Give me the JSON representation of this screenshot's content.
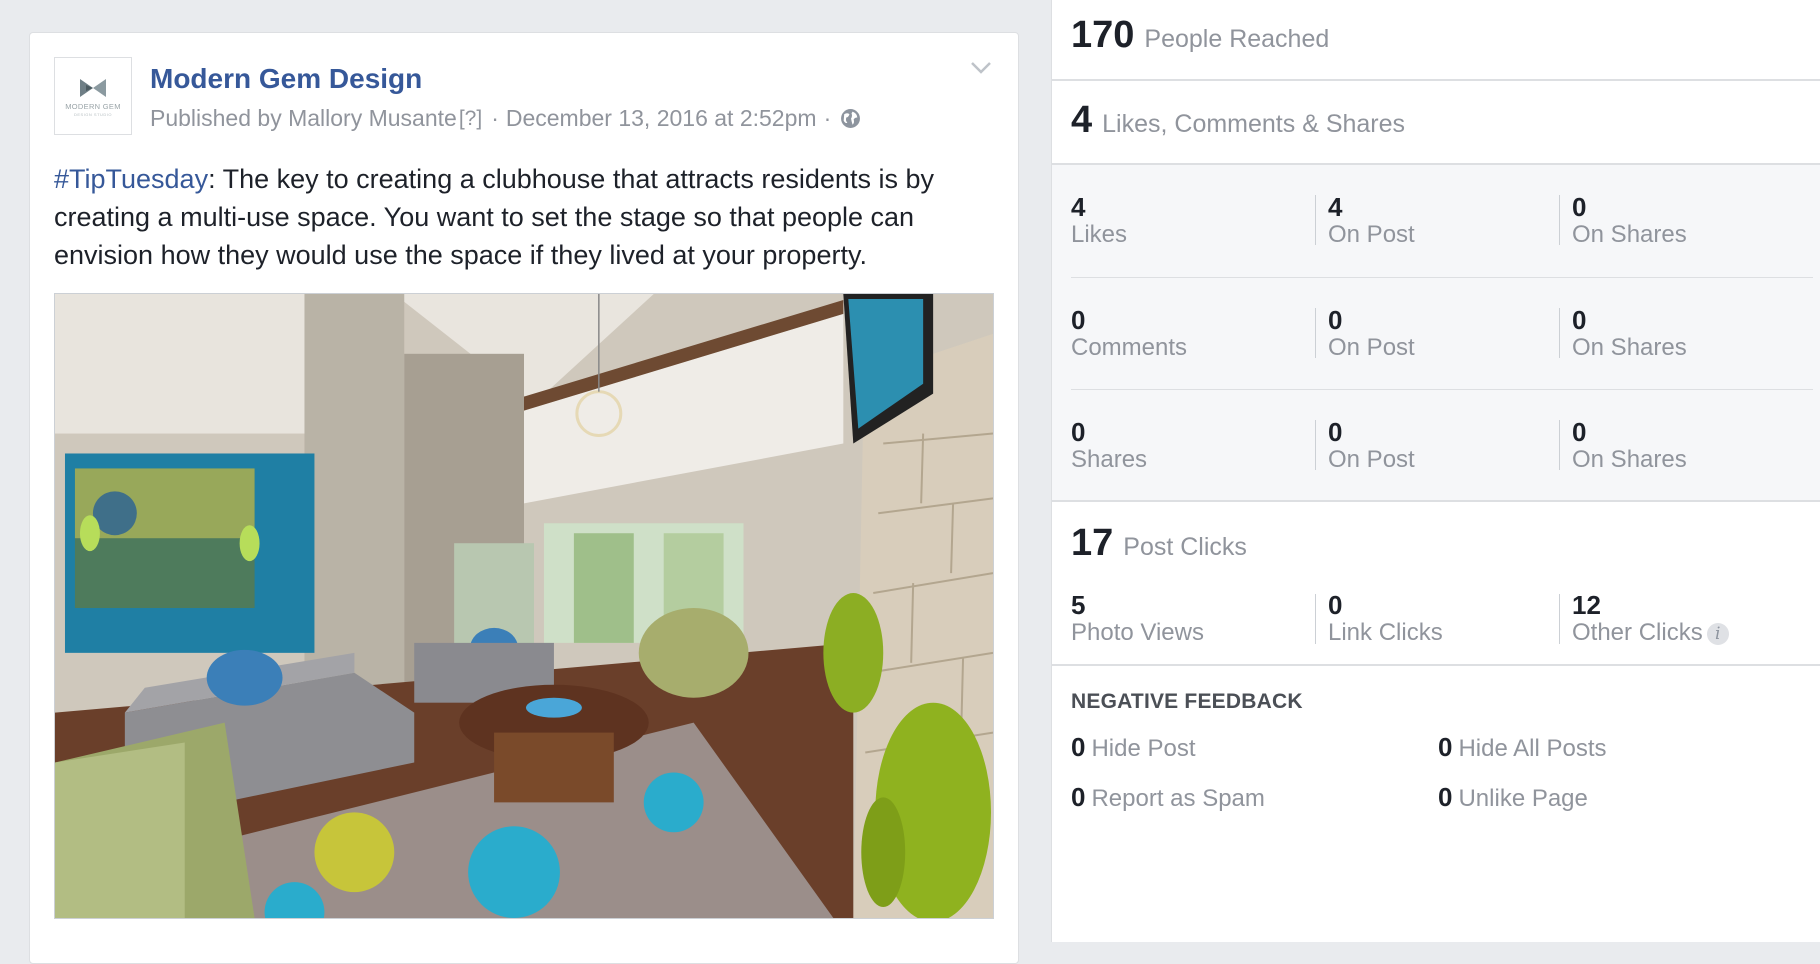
{
  "post": {
    "page_name": "Modern Gem Design",
    "avatar_text": "MODERN GEM",
    "avatar_subtext": "DESIGN STUDIO",
    "published_by": "Published by Mallory Musante",
    "help_marker": "[?]",
    "separator": "·",
    "date": "December 13, 2016 at 2:52pm",
    "hashtag": "#TipTuesday",
    "body": ": The key to creating a clubhouse that attracts residents is by creating a multi-use space. You want to set the stage so that people can envision how they would use the space if they lived at your property.",
    "colors": {
      "link": "#365899",
      "text": "#1d2129",
      "meta": "#90949c"
    }
  },
  "insights": {
    "reach": {
      "value": "170",
      "label": "People Reached"
    },
    "engagement": {
      "value": "4",
      "label": "Likes, Comments & Shares"
    },
    "rows": [
      {
        "cells": [
          {
            "value": "4",
            "label": "Likes"
          },
          {
            "value": "4",
            "label": "On Post"
          },
          {
            "value": "0",
            "label": "On Shares"
          }
        ]
      },
      {
        "cells": [
          {
            "value": "0",
            "label": "Comments"
          },
          {
            "value": "0",
            "label": "On Post"
          },
          {
            "value": "0",
            "label": "On Shares"
          }
        ]
      },
      {
        "cells": [
          {
            "value": "0",
            "label": "Shares"
          },
          {
            "value": "0",
            "label": "On Post"
          },
          {
            "value": "0",
            "label": "On Shares"
          }
        ]
      }
    ],
    "clicks": {
      "value": "17",
      "label": "Post Clicks",
      "cells": [
        {
          "value": "5",
          "label": "Photo Views"
        },
        {
          "value": "0",
          "label": "Link Clicks"
        },
        {
          "value": "12",
          "label": "Other Clicks"
        }
      ],
      "info_glyph": "i"
    },
    "negative": {
      "title": "NEGATIVE FEEDBACK",
      "items": [
        {
          "value": "0",
          "label": "Hide Post"
        },
        {
          "value": "0",
          "label": "Hide All Posts"
        },
        {
          "value": "0",
          "label": "Report as Spam"
        },
        {
          "value": "0",
          "label": "Unlike Page"
        }
      ]
    }
  }
}
